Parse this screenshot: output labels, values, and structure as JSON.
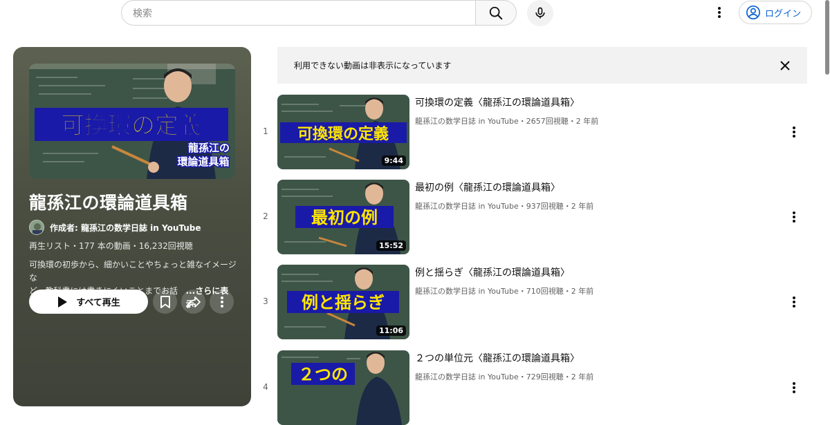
{
  "header": {
    "search_placeholder": "検索",
    "login_label": "ログイン"
  },
  "playlist": {
    "hero_caption": "可換環の定義",
    "hero_sub1": "龍孫江の",
    "hero_sub2": "環論道具箱",
    "title": "龍孫江の環論道具箱",
    "author": "作成者: 龍孫江の数学日誌 in YouTube",
    "meta": "再生リスト・177 本の動画・16,232回視聴",
    "description_line1": "可換環の初歩から、細かいことやちょっと雑なイメージな",
    "description_line2": "ど、教科書には書きにくいことまでお話し",
    "more_label": "...さらに表示",
    "play_all_label": "すべて再生"
  },
  "notice": {
    "text": "利用できない動画は非表示になっています"
  },
  "videos": [
    {
      "index": "1",
      "title": "可換環の定義〈龍孫江の環論道具箱〉",
      "meta": "龍孫江の数学日誌 in YouTube・2657回視聴・2 年前",
      "duration": "9:44",
      "caption": "可換環の定義"
    },
    {
      "index": "2",
      "title": "最初の例〈龍孫江の環論道具箱〉",
      "meta": "龍孫江の数学日誌 in YouTube・937回視聴・2 年前",
      "duration": "15:52",
      "caption": "最初の例"
    },
    {
      "index": "3",
      "title": "例と揺らぎ〈龍孫江の環論道具箱〉",
      "meta": "龍孫江の数学日誌 in YouTube・710回視聴・2 年前",
      "duration": "11:06",
      "caption": "例と揺らぎ"
    },
    {
      "index": "4",
      "title": "２つの単位元〈龍孫江の環論道具箱〉",
      "meta": "龍孫江の数学日誌 in YouTube・729回視聴・2 年前",
      "duration": "",
      "caption": "２つの"
    }
  ],
  "colors": {
    "accent_link": "#065fd4",
    "caption_fill": "#ffe600",
    "caption_bg": "#1a1aa8"
  },
  "icons": [
    "search-icon",
    "mic-icon",
    "more-vert-icon",
    "account-circle-icon",
    "close-icon",
    "play-icon",
    "save-icon",
    "share-icon"
  ]
}
